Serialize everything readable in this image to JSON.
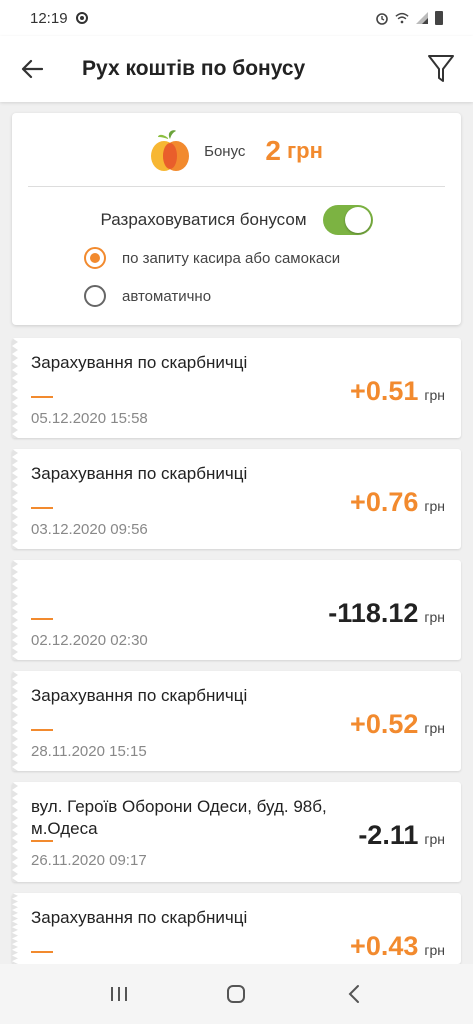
{
  "status_bar": {
    "time": "12:19"
  },
  "app_bar": {
    "title": "Рух коштів по бонусу"
  },
  "bonus_card": {
    "label": "Бонус",
    "value": "2",
    "unit": "грн",
    "toggle_label": "Разраховуватися бонусом",
    "toggle_on": true,
    "options": [
      {
        "label": "по запиту касира або самокаси",
        "checked": true
      },
      {
        "label": "автоматично",
        "checked": false
      }
    ]
  },
  "transactions": [
    {
      "title": "Зарахування по скарбничці",
      "amount": "+0.51",
      "unit": "грн",
      "date": "05.12.2020 15:58",
      "positive": true
    },
    {
      "title": "Зарахування по скарбничці",
      "amount": "+0.76",
      "unit": "грн",
      "date": "03.12.2020 09:56",
      "positive": true
    },
    {
      "title": "",
      "amount": "-118.12",
      "unit": "грн",
      "date": "02.12.2020 02:30",
      "positive": false
    },
    {
      "title": "Зарахування по скарбничці",
      "amount": "+0.52",
      "unit": "грн",
      "date": "28.11.2020 15:15",
      "positive": true
    },
    {
      "title": "вул. Героїв Оборони Одеси, буд. 98б, м.Одеса",
      "amount": "-2.11",
      "unit": "грн",
      "date": "26.11.2020 09:17",
      "positive": false
    },
    {
      "title": "Зарахування по скарбничці",
      "amount": "+0.43",
      "unit": "грн",
      "date": "",
      "positive": true
    }
  ],
  "colors": {
    "accent": "#f28a2e",
    "toggle": "#7cb342"
  },
  "icons": [
    "back-arrow-icon",
    "filter-icon",
    "fruit-logo-icon",
    "recent-apps-icon",
    "home-icon",
    "back-nav-icon"
  ]
}
